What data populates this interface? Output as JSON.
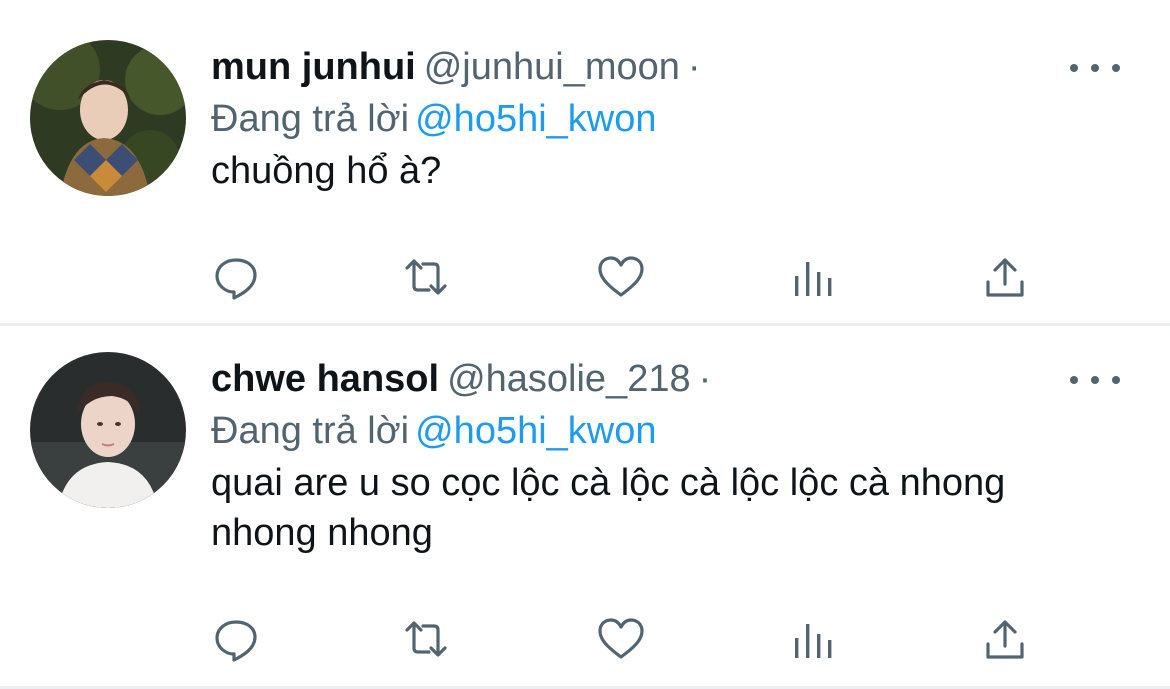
{
  "tweets": [
    {
      "display_name": "mun junhui",
      "handle": "@junhui_moon",
      "separator": "·",
      "reply_prefix": "Đang trả lời",
      "reply_to": "@ho5hi_kwon",
      "text": "chuồng hổ à?",
      "avatar_colors": {
        "background": "#3d4a2a",
        "accent": "#8a6a3c"
      }
    },
    {
      "display_name": "chwe hansol",
      "handle": "@hasolie_218",
      "separator": "·",
      "reply_prefix": "Đang trả lời",
      "reply_to": "@ho5hi_kwon",
      "text": "quai are u so cọc lộc cà lộc cà lộc lộc cà nhong nhong nhong",
      "avatar_colors": {
        "background": "#2f3233",
        "accent": "#e8d3c6"
      }
    }
  ],
  "icons": [
    "reply-icon",
    "retweet-icon",
    "like-icon",
    "stats-icon",
    "share-icon",
    "more-icon"
  ],
  "colors": {
    "text": "#0f1419",
    "secondary": "#536471",
    "link": "#1d9bf0",
    "divider": "#eceff1"
  }
}
